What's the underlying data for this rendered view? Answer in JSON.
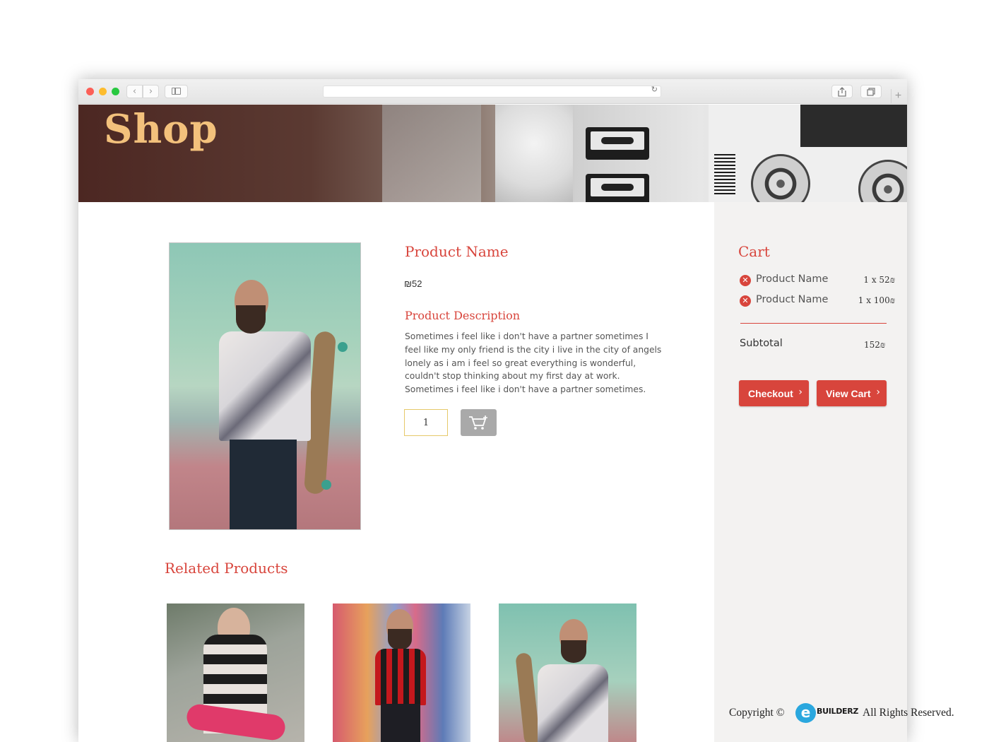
{
  "banner": {
    "title": "Shop"
  },
  "product": {
    "name": "Product Name",
    "price": "₪52",
    "description_title": "Product Description",
    "description": "Sometimes i feel like i don't have a partner sometimes I\nfeel like my only friend is the city i live in the city of angels\nlonely as i am i feel so great everything is wonderful,\ncouldn't stop  thinking about my first day at work.\nSometimes i feel like i don't have a partner sometimes.",
    "quantity": "1",
    "add_to_cart_icon": "cart-plus-icon"
  },
  "related": {
    "title": "Related Products",
    "items": [
      {
        "image": "woman-with-skateboard"
      },
      {
        "image": "man-in-plaid-shirt"
      },
      {
        "image": "bearded-man-with-longboard"
      }
    ]
  },
  "cart": {
    "title": "Cart",
    "items": [
      {
        "name": "Product Name",
        "qty_price": "1 x 52₪"
      },
      {
        "name": "Product Name",
        "qty_price": "1 x 100₪"
      }
    ],
    "subtotal_label": "Subtotal",
    "subtotal_value": "152₪",
    "checkout_label": "Checkout",
    "view_cart_label": "View Cart"
  },
  "footer": {
    "copyright_prefix": "Copyright ©",
    "logo_text": "BUILDERZ",
    "rights": "All Rights Reserved."
  },
  "colors": {
    "accent": "#d8453c",
    "banner_title": "#f3c17c",
    "sidebar_bg": "#f3f2f1"
  }
}
